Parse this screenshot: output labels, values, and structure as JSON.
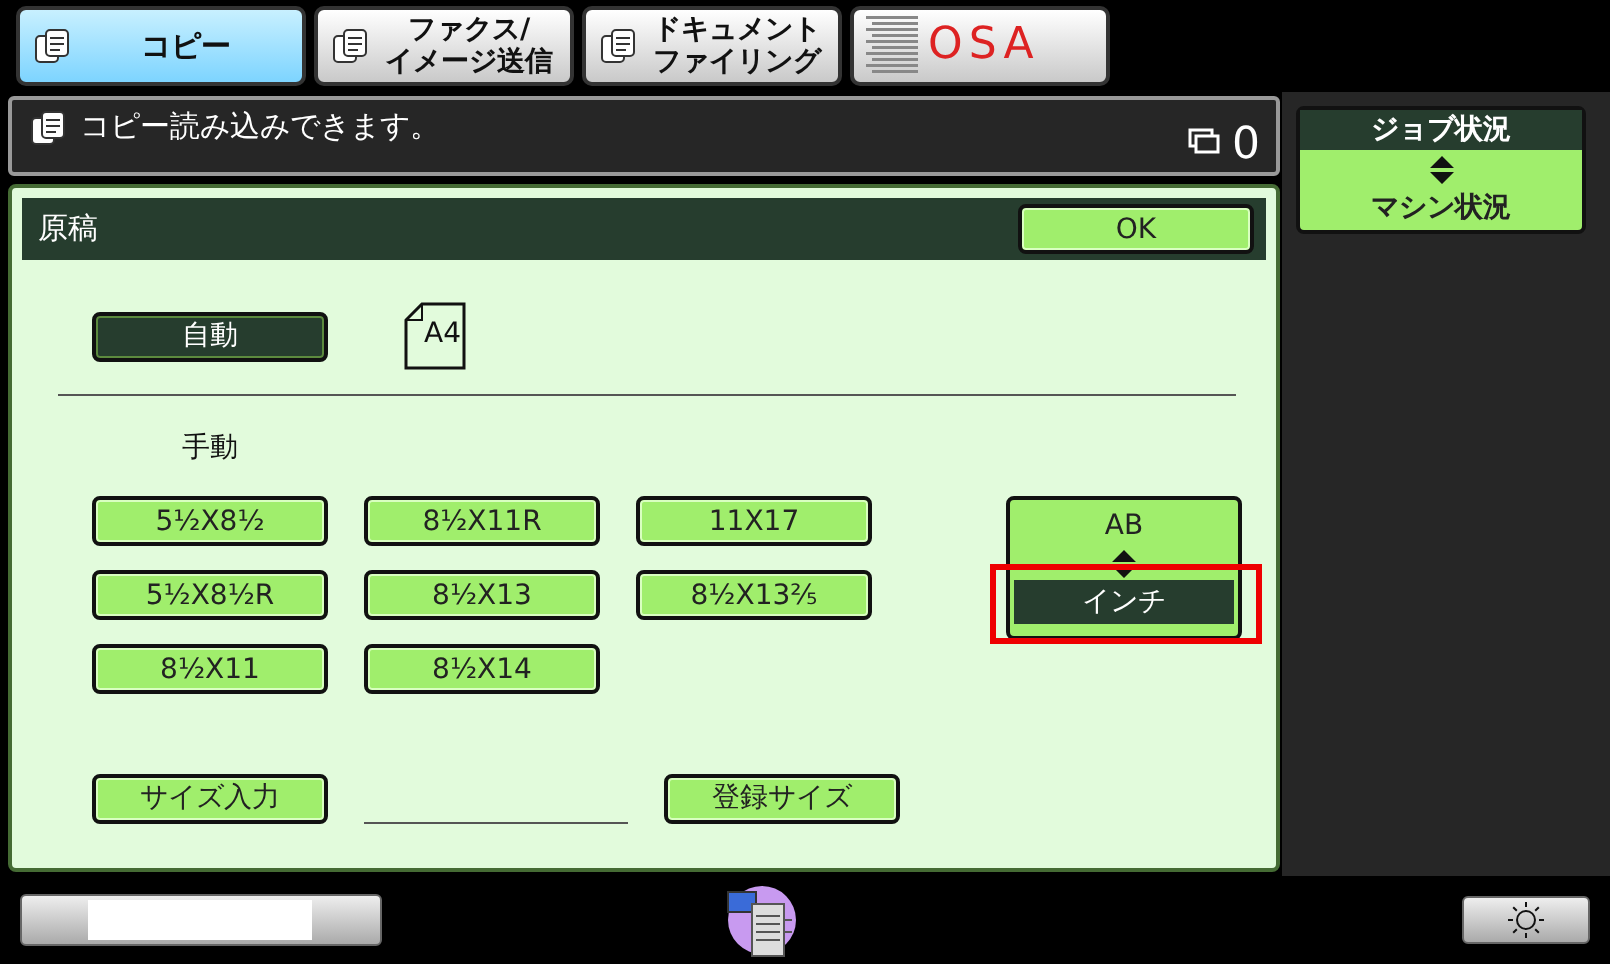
{
  "tabs": [
    {
      "lines": [
        "コピー"
      ],
      "selected": true,
      "kind": "text"
    },
    {
      "lines": [
        "ファクス/",
        "イメージ送信"
      ],
      "selected": false,
      "kind": "text"
    },
    {
      "lines": [
        "ドキュメント",
        "ファイリング"
      ],
      "selected": false,
      "kind": "text"
    },
    {
      "lines": [
        "OSA"
      ],
      "selected": false,
      "kind": "logo"
    }
  ],
  "message": {
    "text": "コピー読み込みできます。",
    "count": "0"
  },
  "status_button": {
    "top": "ジョブ状況",
    "bottom": "マシン状況"
  },
  "panel": {
    "title": "原稿",
    "ok": "OK",
    "auto": {
      "label": "自動",
      "selected": true
    },
    "paper": "A4",
    "manual_label": "手動",
    "sizes": [
      {
        "label": "5½X8½",
        "selected": false
      },
      {
        "label": "8½X11R",
        "selected": false
      },
      {
        "label": "11X17",
        "selected": false
      },
      {
        "label": "5½X8½R",
        "selected": false
      },
      {
        "label": "8½X13",
        "selected": false
      },
      {
        "label": "8½X13⅖",
        "selected": false
      },
      {
        "label": "8½X11",
        "selected": false
      },
      {
        "label": "8½X14",
        "selected": false
      }
    ],
    "units": [
      {
        "label": "AB",
        "selected": false
      },
      {
        "label": "インチ",
        "selected": true,
        "highlighted": true
      }
    ],
    "size_input": "サイズ入力",
    "registered_size": "登録サイズ"
  }
}
